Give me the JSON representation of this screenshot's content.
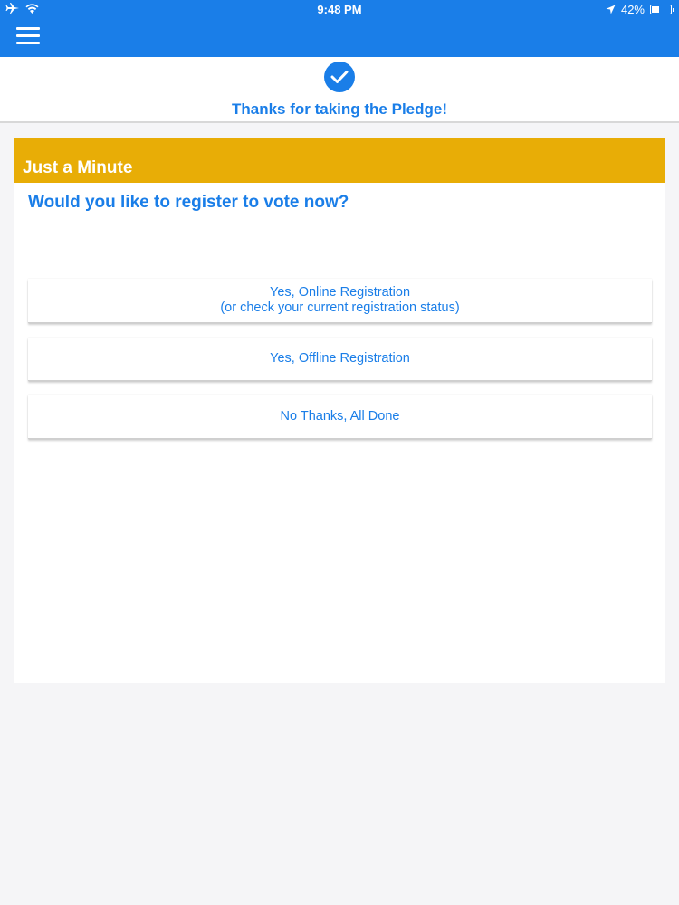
{
  "status_bar": {
    "time": "9:48 PM",
    "battery_percent": "42%",
    "battery_level": 0.42
  },
  "header": {
    "menu_icon": "hamburger-icon"
  },
  "pledge": {
    "icon": "check-circle-icon",
    "title": "Thanks for taking the Pledge!"
  },
  "card": {
    "title": "Just a Minute",
    "question": "Would you like to register to vote now?",
    "options": [
      {
        "line1": "Yes, Online Registration",
        "line2": "(or check your current registration status)"
      },
      {
        "line1": "Yes, Offline Registration"
      },
      {
        "line1": "No Thanks, All Done"
      }
    ]
  },
  "colors": {
    "primary": "#1a7ee8",
    "accent": "#e8ad06",
    "background": "#f5f5f7"
  }
}
